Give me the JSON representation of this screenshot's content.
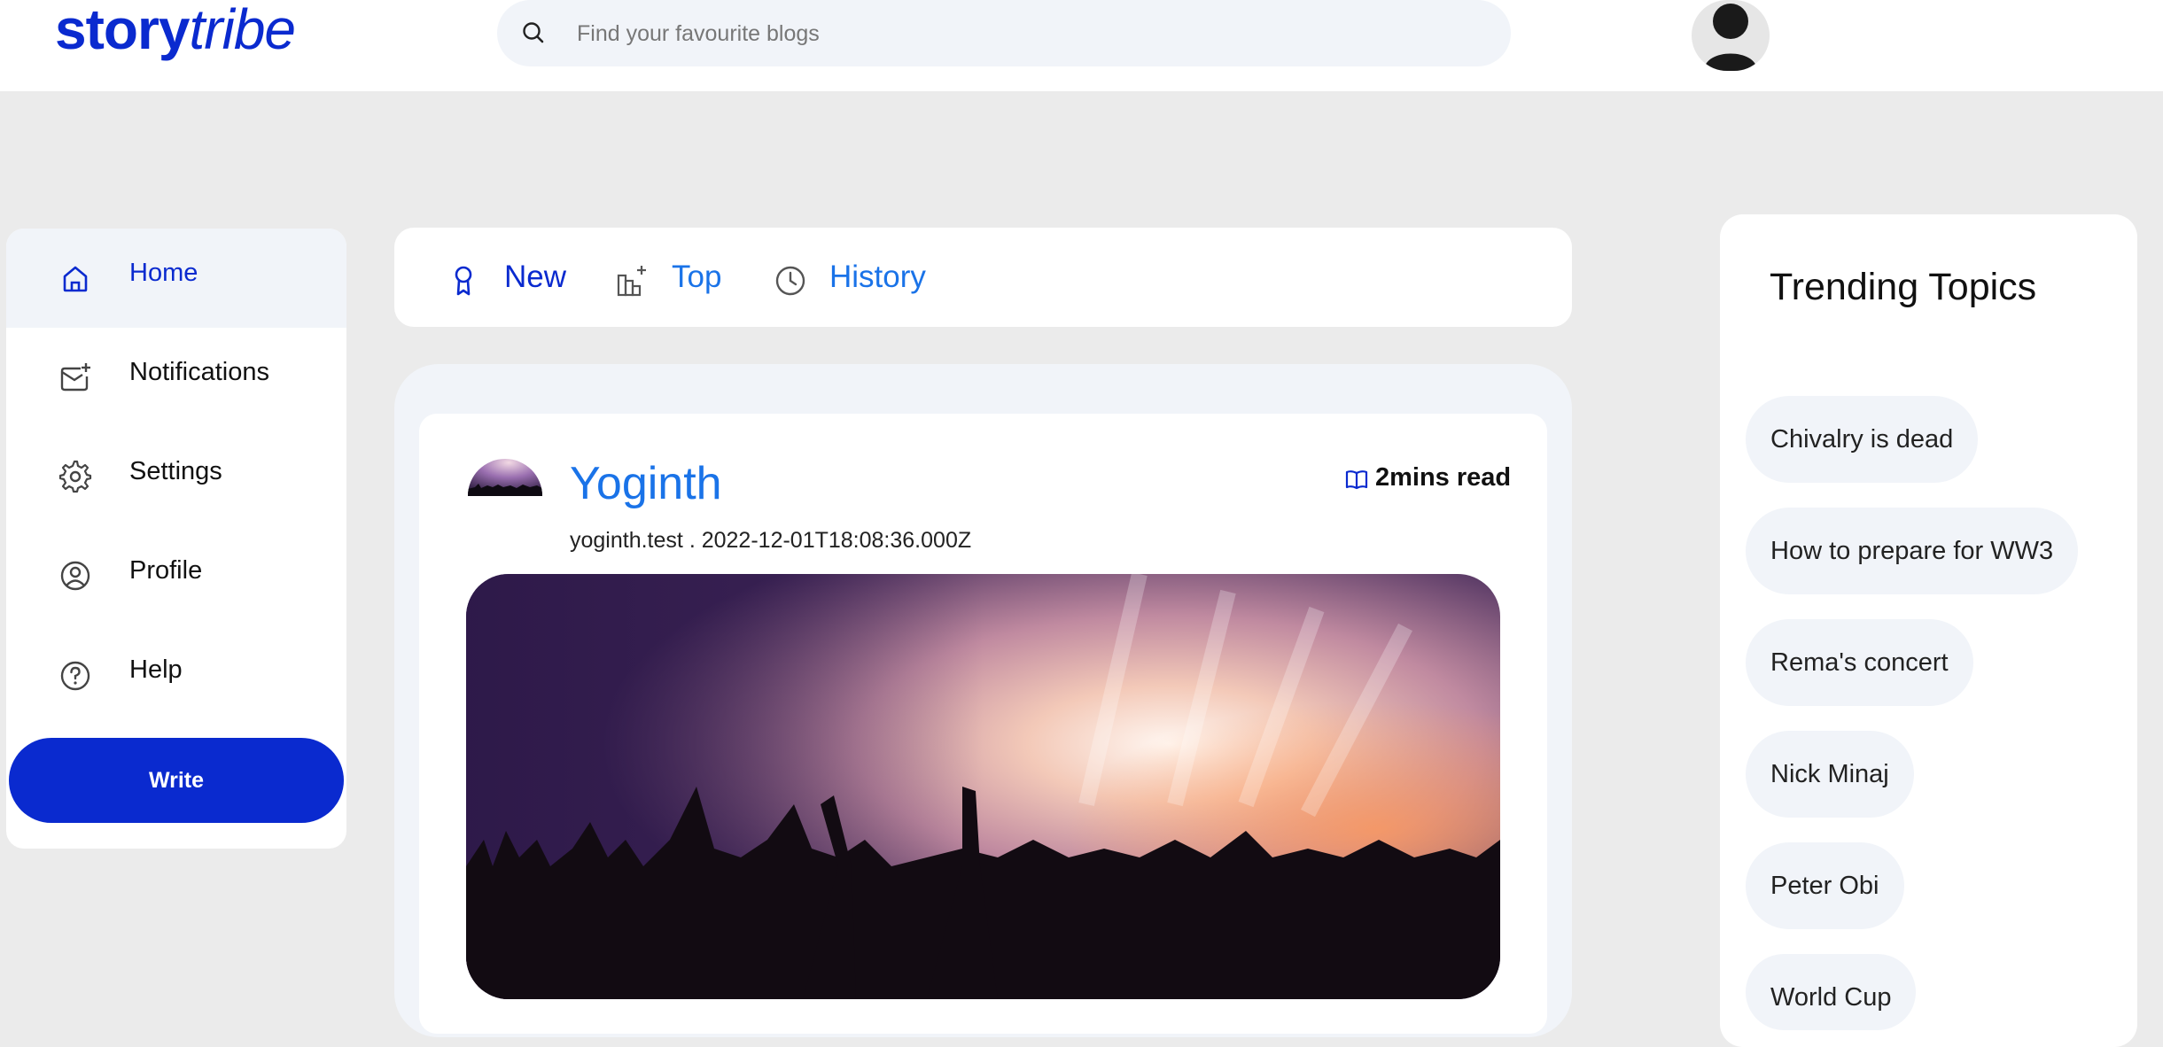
{
  "brand": {
    "part1": "story",
    "part2": "tribe"
  },
  "search": {
    "placeholder": "Find your favourite blogs"
  },
  "sidebar": {
    "items": [
      {
        "label": "Home",
        "icon": "home-icon"
      },
      {
        "label": "Notifications",
        "icon": "mail-plus-icon"
      },
      {
        "label": "Settings",
        "icon": "gear-icon"
      },
      {
        "label": "Profile",
        "icon": "user-circle-icon"
      },
      {
        "label": "Help",
        "icon": "question-circle-icon"
      }
    ],
    "write_label": "Write"
  },
  "tabs": [
    {
      "label": "New",
      "icon": "ribbon-icon"
    },
    {
      "label": "Top",
      "icon": "chart-plus-icon"
    },
    {
      "label": "History",
      "icon": "clock-icon"
    }
  ],
  "post": {
    "author": "Yoginth",
    "handle": "yoginth.test",
    "separator": ".",
    "date": "2022-12-01T18:08:36.000Z",
    "read_time": "2mins read"
  },
  "trending": {
    "title": "Trending Topics",
    "topics": [
      "Chivalry is dead",
      "How to prepare for WW3",
      "Rema's concert",
      "Nick Minaj",
      "Peter Obi",
      "World Cup"
    ]
  },
  "colors": {
    "brand": "#0a2acf",
    "link": "#1a73e8",
    "page_bg": "#ebebeb",
    "soft_panel": "#f1f4f9"
  }
}
